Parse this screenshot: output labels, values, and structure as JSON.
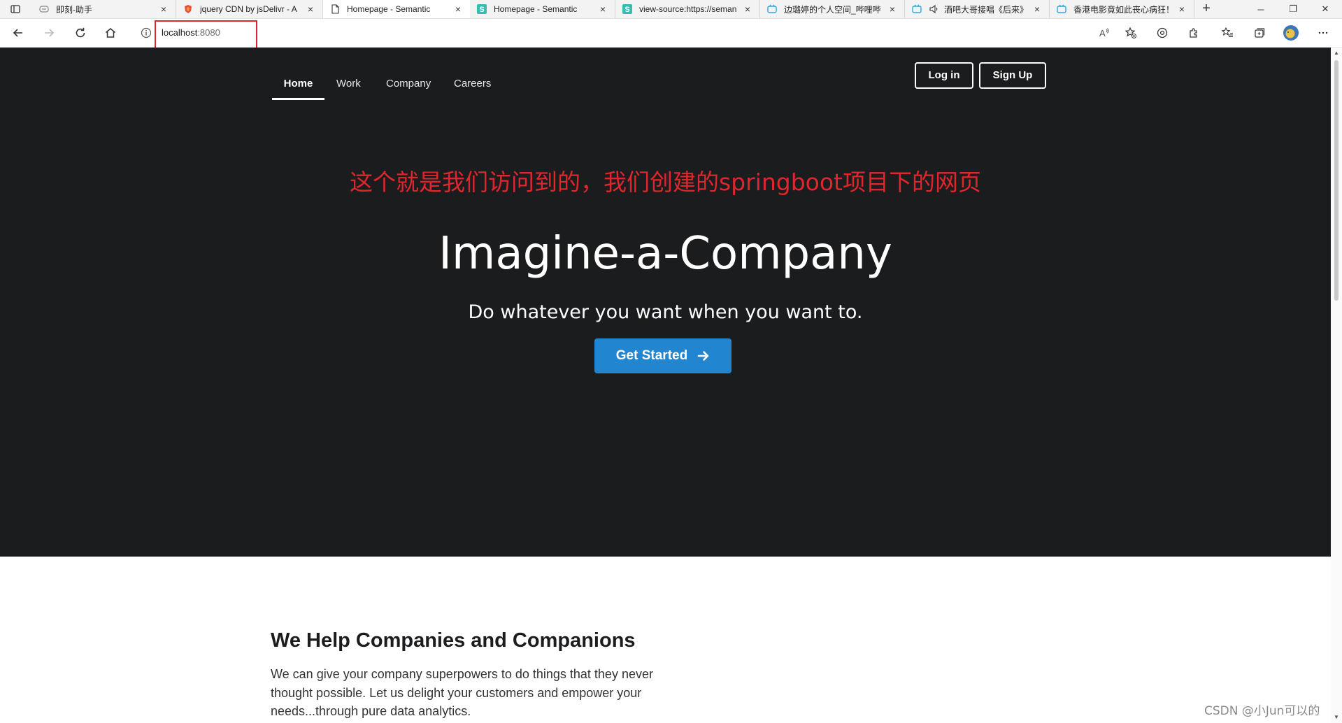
{
  "browser": {
    "tabs": [
      {
        "title": "即刻-助手",
        "icon": "globe-icon",
        "active": false
      },
      {
        "title": "jquery CDN by jsDelivr - A",
        "icon": "jsdelivr-icon",
        "active": false
      },
      {
        "title": "Homepage - Semantic",
        "icon": "page-icon",
        "active": true
      },
      {
        "title": "Homepage - Semantic",
        "icon": "semantic-s-icon",
        "active": false
      },
      {
        "title": "view-source:https://seman",
        "icon": "semantic-s-icon",
        "active": false
      },
      {
        "title": "边璐婷的个人空间_哔哩哔",
        "icon": "bilibili-icon",
        "active": false
      },
      {
        "title": "酒吧大哥接唱《后来》",
        "icon": "bilibili-icon",
        "active": false
      },
      {
        "title": "香港电影竟如此丧心病狂！",
        "icon": "bilibili-icon",
        "active": false
      }
    ],
    "address": {
      "host": "localhost",
      "port": ":8080"
    }
  },
  "nav": {
    "items": [
      "Home",
      "Work",
      "Company",
      "Careers"
    ],
    "login": "Log in",
    "signup": "Sign Up"
  },
  "annotation": "这个就是我们访问到的，我们创建的springboot项目下的网页",
  "hero": {
    "title": "Imagine-a-Company",
    "subtitle": "Do whatever you want when you want to.",
    "cta": "Get Started"
  },
  "section": {
    "heading": "We Help Companies and Companions",
    "body": "We can give your company superpowers to do things that they never thought possible. Let us delight your customers and empower your needs...through pure data analytics."
  },
  "watermark": "CSDN @小Jun可以的",
  "colors": {
    "hero_bg": "#1b1c1d",
    "primary": "#2185d0",
    "annotation": "#e0262d"
  }
}
